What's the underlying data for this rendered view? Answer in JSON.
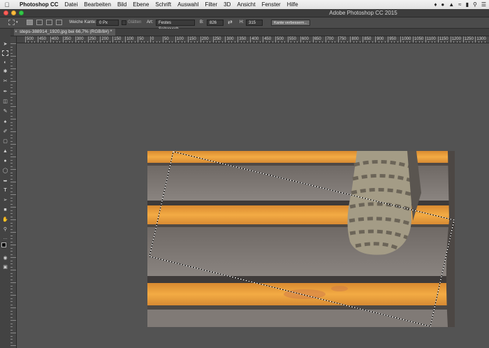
{
  "menubar": {
    "app": "Photoshop CC",
    "items": [
      "Datei",
      "Bearbeiten",
      "Bild",
      "Ebene",
      "Schrift",
      "Auswahl",
      "Filter",
      "3D",
      "Ansicht",
      "Fenster",
      "Hilfe"
    ]
  },
  "window": {
    "title": "Adobe Photoshop CC 2015"
  },
  "options": {
    "feather_label": "Weiche Kante:",
    "feather_value": "0 Px",
    "antialias_label": "Glätten",
    "style_label": "Art:",
    "style_value": "Festes Seitenverh.",
    "width_label": "B:",
    "width_value": "826",
    "height_label": "H:",
    "height_value": "315",
    "refine_button": "Kante verbessern..."
  },
  "document": {
    "tab_label": "steps-388914_1920.jpg bei 66,7% (RGB/8#) *"
  },
  "ruler": {
    "labels": [
      "500",
      "450",
      "400",
      "350",
      "300",
      "250",
      "200",
      "150",
      "100",
      "50",
      "0",
      "50",
      "100",
      "150",
      "200",
      "250",
      "300",
      "350",
      "400",
      "450",
      "500",
      "550",
      "600",
      "650",
      "700",
      "750",
      "800",
      "850",
      "900",
      "950",
      "1000",
      "1050",
      "1100",
      "1150",
      "1200",
      "1250",
      "1300"
    ]
  },
  "colors": {
    "accent_stripe": "#f2a53c",
    "photo_gray": "#7a7570"
  }
}
